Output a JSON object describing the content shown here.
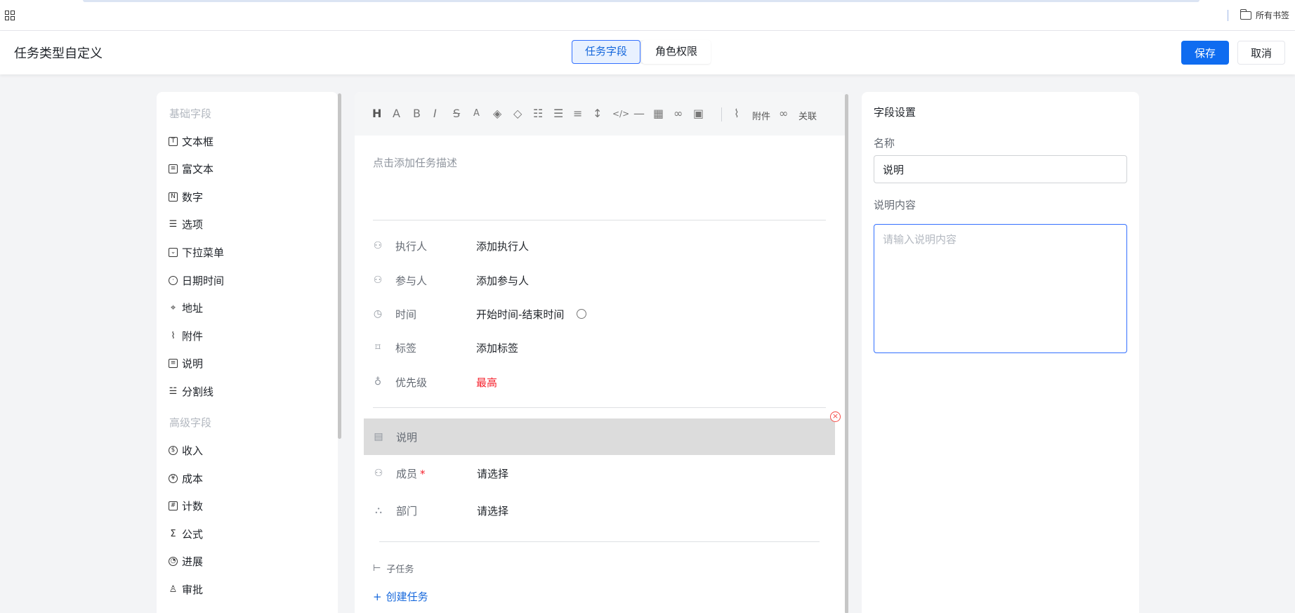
{
  "browser": {
    "all_bookmarks": "所有书签"
  },
  "header": {
    "title": "任务类型自定义",
    "tabs": [
      {
        "label": "任务字段",
        "active": true
      },
      {
        "label": "角色权限",
        "active": false
      }
    ],
    "save_label": "保存",
    "cancel_label": "取消",
    "accent_color": "#0f6cf0"
  },
  "fields_panel": {
    "basic_title": "基础字段",
    "basic_items": [
      {
        "label": "文本框",
        "icon": "text-box-icon"
      },
      {
        "label": "富文本",
        "icon": "rich-text-icon"
      },
      {
        "label": "数字",
        "icon": "number-icon"
      },
      {
        "label": "选项",
        "icon": "checklist-icon"
      },
      {
        "label": "下拉菜单",
        "icon": "dropdown-icon"
      },
      {
        "label": "日期时间",
        "icon": "clock-icon"
      },
      {
        "label": "地址",
        "icon": "location-pin-icon"
      },
      {
        "label": "附件",
        "icon": "paperclip-icon"
      },
      {
        "label": "说明",
        "icon": "document-icon"
      },
      {
        "label": "分割线",
        "icon": "divider-icon"
      }
    ],
    "advanced_title": "高级字段",
    "advanced_items": [
      {
        "label": "收入",
        "icon": "dollar-icon"
      },
      {
        "label": "成本",
        "icon": "cost-icon"
      },
      {
        "label": "计数",
        "icon": "counter-icon"
      },
      {
        "label": "公式",
        "icon": "sigma-icon"
      },
      {
        "label": "进展",
        "icon": "progress-icon"
      },
      {
        "label": "审批",
        "icon": "stamp-icon"
      }
    ]
  },
  "editor": {
    "toolbar": {
      "attachment_label": "附件",
      "link_label": "关联"
    },
    "description_placeholder": "点击添加任务描述",
    "rows": [
      {
        "icon": "person-icon",
        "label": "执行人",
        "value": "添加执行人"
      },
      {
        "icon": "people-icon",
        "label": "参与人",
        "value": "添加参与人"
      },
      {
        "icon": "clock-icon",
        "label": "时间",
        "value": "开始时间-结束时间"
      },
      {
        "icon": "bookmark-icon",
        "label": "标签",
        "value": "添加标签"
      },
      {
        "icon": "bulb-icon",
        "label": "优先级",
        "value": "最高"
      }
    ],
    "custom_rows": [
      {
        "icon": "document-icon",
        "label": "说明",
        "value": "",
        "selected": true
      },
      {
        "icon": "person-icon",
        "label": "成员",
        "value": "请选择",
        "required": true
      },
      {
        "icon": "org-icon",
        "label": "部门",
        "value": "请选择"
      }
    ],
    "required_mark": "*",
    "subtask_label": "子任务",
    "create_task_label": "创建任务",
    "priority_color": "#f5222d"
  },
  "settings": {
    "title": "字段设置",
    "name_label": "名称",
    "name_value": "说明",
    "content_label": "说明内容",
    "content_placeholder": "请输入说明内容"
  }
}
